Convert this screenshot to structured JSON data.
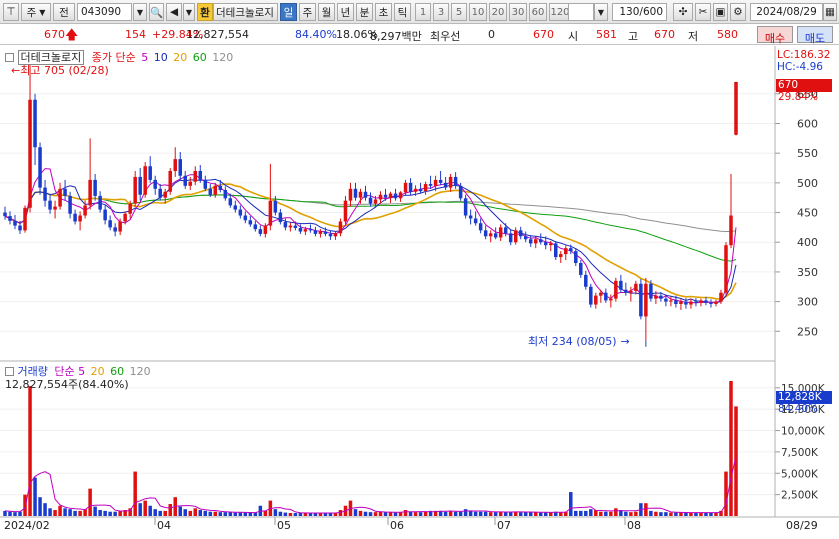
{
  "toolbar": {
    "type_label": "주",
    "market_label": "전",
    "code": "043090",
    "exchange_btn": "환",
    "stock_name": "더테크놀로지",
    "periods": [
      "일",
      "주",
      "월",
      "년",
      "분",
      "초",
      "틱"
    ],
    "active_period": "일",
    "intervals": [
      "1",
      "3",
      "5",
      "10",
      "20",
      "30",
      "60",
      "120"
    ],
    "count": "130/600",
    "date": "2024/08/29"
  },
  "quote": {
    "price": "670",
    "change": "154",
    "change_pct": "+29.84%",
    "volume": "12,827,554",
    "vol_ratio": "84.40%",
    "turnover": "18.06%",
    "amount": "8,297백만",
    "best_bid_label": "최우선",
    "best_bid": "0",
    "best_ask": "670",
    "open_label": "시",
    "open": "581",
    "high_label": "고",
    "high": "670",
    "low_label": "저",
    "low": "580",
    "buy_btn": "매수",
    "sell_btn": "매도"
  },
  "price_panel": {
    "name_tag": "더테크놀로지",
    "ma_label": "종가 단순",
    "ma_periods": [
      "5",
      "10",
      "20",
      "60",
      "120"
    ],
    "lc_label": "LC:186.32",
    "hc_label": "HC:-4.96",
    "current_price_tag": "670",
    "current_pct_tag": "29.84%",
    "high_annotation": "최고 705 (02/28)",
    "low_annotation": "최저 234 (08/05)",
    "y_ticks": [
      250,
      300,
      350,
      400,
      450,
      500,
      550,
      600,
      650
    ]
  },
  "volume_panel": {
    "label": "거래량",
    "ma_label": "단순",
    "ma_periods": [
      "5",
      "20",
      "60",
      "120"
    ],
    "volume_text": "12,827,554주(84.40%)",
    "current_tag": "12,828K",
    "current_pct_tag": "84.40%",
    "y_ticks": [
      "15,000K",
      "12,500K",
      "10,000K",
      "7,500K",
      "5,000K",
      "2,500K"
    ]
  },
  "x_axis": {
    "labels": [
      "2024/02",
      "04",
      "05",
      "06",
      "07",
      "08"
    ],
    "last_date": "08/29"
  },
  "colors": {
    "up": "#e01010",
    "down": "#1a3ccc",
    "ma5": "#c000c0",
    "ma10": "#1a2ab8",
    "ma20": "#e0a000",
    "ma60": "#10a010",
    "ma120": "#909090"
  },
  "chart_data": {
    "type": "candlestick",
    "y_range": [
      205,
      712
    ],
    "volume_range_k": [
      0,
      16500
    ],
    "candles": [
      [
        450,
        460,
        438,
        444,
        600
      ],
      [
        444,
        452,
        430,
        436,
        500
      ],
      [
        436,
        446,
        422,
        428,
        450
      ],
      [
        428,
        436,
        414,
        420,
        500
      ],
      [
        420,
        462,
        416,
        458,
        2500
      ],
      [
        458,
        705,
        450,
        640,
        15200
      ],
      [
        640,
        650,
        530,
        560,
        4500
      ],
      [
        560,
        568,
        480,
        492,
        2200
      ],
      [
        492,
        505,
        460,
        470,
        1500
      ],
      [
        470,
        480,
        448,
        455,
        900
      ],
      [
        455,
        470,
        440,
        460,
        700
      ],
      [
        460,
        500,
        455,
        490,
        1200
      ],
      [
        490,
        505,
        470,
        478,
        900
      ],
      [
        478,
        485,
        440,
        448,
        800
      ],
      [
        448,
        455,
        430,
        435,
        600
      ],
      [
        435,
        452,
        420,
        445,
        600
      ],
      [
        445,
        470,
        440,
        462,
        800
      ],
      [
        462,
        575,
        455,
        505,
        3200
      ],
      [
        505,
        515,
        470,
        478,
        1100
      ],
      [
        478,
        486,
        450,
        455,
        700
      ],
      [
        455,
        462,
        430,
        437,
        600
      ],
      [
        437,
        445,
        420,
        425,
        500
      ],
      [
        425,
        432,
        410,
        418,
        500
      ],
      [
        418,
        440,
        412,
        435,
        600
      ],
      [
        435,
        452,
        430,
        448,
        700
      ],
      [
        448,
        470,
        440,
        465,
        900
      ],
      [
        465,
        520,
        460,
        510,
        5200
      ],
      [
        510,
        525,
        470,
        480,
        1500
      ],
      [
        480,
        535,
        475,
        528,
        1800
      ],
      [
        528,
        545,
        500,
        505,
        1200
      ],
      [
        505,
        512,
        480,
        490,
        800
      ],
      [
        490,
        498,
        470,
        475,
        600
      ],
      [
        475,
        490,
        465,
        485,
        600
      ],
      [
        485,
        525,
        480,
        520,
        1400
      ],
      [
        520,
        560,
        510,
        540,
        2200
      ],
      [
        540,
        552,
        505,
        512,
        1100
      ],
      [
        512,
        520,
        490,
        495,
        800
      ],
      [
        495,
        510,
        488,
        502,
        600
      ],
      [
        502,
        528,
        496,
        520,
        900
      ],
      [
        520,
        530,
        500,
        505,
        700
      ],
      [
        505,
        512,
        486,
        490,
        600
      ],
      [
        490,
        498,
        476,
        480,
        500
      ],
      [
        480,
        500,
        475,
        495,
        500
      ],
      [
        495,
        505,
        484,
        488,
        450
      ],
      [
        488,
        494,
        470,
        474,
        450
      ],
      [
        474,
        482,
        458,
        462,
        450
      ],
      [
        462,
        470,
        450,
        455,
        400
      ],
      [
        455,
        462,
        440,
        445,
        400
      ],
      [
        445,
        452,
        432,
        437,
        400
      ],
      [
        437,
        444,
        426,
        430,
        400
      ],
      [
        430,
        436,
        418,
        422,
        400
      ],
      [
        422,
        428,
        410,
        414,
        1200
      ],
      [
        414,
        432,
        408,
        428,
        600
      ],
      [
        428,
        532,
        420,
        470,
        1800
      ],
      [
        470,
        478,
        445,
        450,
        800
      ],
      [
        450,
        456,
        430,
        434,
        500
      ],
      [
        434,
        440,
        420,
        425,
        400
      ],
      [
        425,
        433,
        418,
        428,
        350
      ],
      [
        428,
        435,
        420,
        424,
        350
      ],
      [
        424,
        430,
        414,
        418,
        350
      ],
      [
        418,
        426,
        412,
        422,
        350
      ],
      [
        422,
        430,
        416,
        420,
        350
      ],
      [
        420,
        426,
        410,
        414,
        350
      ],
      [
        414,
        422,
        408,
        418,
        350
      ],
      [
        418,
        425,
        410,
        414,
        350
      ],
      [
        414,
        420,
        404,
        410,
        350
      ],
      [
        410,
        418,
        404,
        415,
        350
      ],
      [
        415,
        440,
        410,
        435,
        700
      ],
      [
        435,
        478,
        430,
        470,
        1200
      ],
      [
        470,
        500,
        460,
        490,
        1800
      ],
      [
        490,
        500,
        470,
        475,
        800
      ],
      [
        475,
        490,
        465,
        485,
        600
      ],
      [
        485,
        495,
        470,
        475,
        500
      ],
      [
        475,
        484,
        460,
        465,
        450
      ],
      [
        465,
        478,
        458,
        472,
        450
      ],
      [
        472,
        486,
        465,
        480,
        500
      ],
      [
        480,
        490,
        470,
        475,
        450
      ],
      [
        475,
        485,
        466,
        482,
        450
      ],
      [
        482,
        490,
        470,
        474,
        400
      ],
      [
        474,
        486,
        468,
        484,
        450
      ],
      [
        484,
        505,
        478,
        500,
        700
      ],
      [
        500,
        508,
        480,
        485,
        500
      ],
      [
        485,
        496,
        478,
        490,
        450
      ],
      [
        490,
        500,
        482,
        486,
        450
      ],
      [
        486,
        502,
        480,
        498,
        500
      ],
      [
        498,
        512,
        490,
        495,
        600
      ],
      [
        495,
        512,
        486,
        505,
        600
      ],
      [
        505,
        520,
        496,
        500,
        600
      ],
      [
        500,
        510,
        488,
        492,
        500
      ],
      [
        492,
        515,
        485,
        510,
        600
      ],
      [
        510,
        518,
        490,
        495,
        500
      ],
      [
        495,
        500,
        470,
        474,
        500
      ],
      [
        474,
        480,
        440,
        445,
        800
      ],
      [
        445,
        455,
        430,
        440,
        600
      ],
      [
        440,
        452,
        428,
        432,
        500
      ],
      [
        432,
        440,
        415,
        420,
        500
      ],
      [
        420,
        428,
        405,
        410,
        500
      ],
      [
        410,
        420,
        400,
        415,
        450
      ],
      [
        415,
        425,
        405,
        408,
        450
      ],
      [
        408,
        430,
        402,
        425,
        500
      ],
      [
        425,
        432,
        410,
        415,
        450
      ],
      [
        415,
        422,
        395,
        400,
        500
      ],
      [
        400,
        425,
        396,
        420,
        500
      ],
      [
        420,
        426,
        405,
        410,
        450
      ],
      [
        410,
        418,
        400,
        405,
        450
      ],
      [
        405,
        412,
        392,
        398,
        450
      ],
      [
        398,
        410,
        390,
        405,
        450
      ],
      [
        405,
        415,
        396,
        400,
        400
      ],
      [
        400,
        410,
        388,
        395,
        400
      ],
      [
        395,
        402,
        385,
        398,
        400
      ],
      [
        398,
        402,
        370,
        375,
        500
      ],
      [
        375,
        385,
        365,
        380,
        450
      ],
      [
        380,
        395,
        370,
        390,
        500
      ],
      [
        390,
        396,
        380,
        385,
        2800
      ],
      [
        385,
        390,
        360,
        365,
        600
      ],
      [
        365,
        370,
        340,
        345,
        600
      ],
      [
        345,
        352,
        320,
        325,
        600
      ],
      [
        325,
        330,
        290,
        295,
        800
      ],
      [
        295,
        315,
        288,
        310,
        700
      ],
      [
        310,
        320,
        298,
        315,
        500
      ],
      [
        315,
        322,
        298,
        302,
        500
      ],
      [
        302,
        312,
        290,
        305,
        500
      ],
      [
        305,
        340,
        300,
        335,
        900
      ],
      [
        335,
        345,
        315,
        320,
        700
      ],
      [
        320,
        332,
        310,
        315,
        500
      ],
      [
        315,
        325,
        300,
        318,
        450
      ],
      [
        318,
        335,
        312,
        330,
        500
      ],
      [
        330,
        338,
        270,
        275,
        1500
      ],
      [
        275,
        340,
        234,
        330,
        1500
      ],
      [
        330,
        336,
        300,
        305,
        600
      ],
      [
        305,
        318,
        296,
        310,
        500
      ],
      [
        310,
        316,
        300,
        305,
        450
      ],
      [
        305,
        312,
        292,
        300,
        450
      ],
      [
        300,
        308,
        292,
        302,
        400
      ],
      [
        302,
        310,
        290,
        296,
        400
      ],
      [
        296,
        304,
        286,
        300,
        400
      ],
      [
        300,
        306,
        288,
        295,
        400
      ],
      [
        295,
        305,
        288,
        300,
        400
      ],
      [
        300,
        306,
        292,
        298,
        400
      ],
      [
        298,
        305,
        292,
        302,
        400
      ],
      [
        302,
        308,
        294,
        298,
        400
      ],
      [
        298,
        304,
        290,
        296,
        400
      ],
      [
        296,
        303,
        292,
        300,
        400
      ],
      [
        300,
        320,
        296,
        315,
        600
      ],
      [
        315,
        400,
        310,
        395,
        5200
      ],
      [
        395,
        515,
        390,
        445,
        15800
      ],
      [
        581,
        670,
        580,
        670,
        12828
      ]
    ],
    "ma_periods": [
      5,
      10,
      20,
      60,
      120
    ],
    "annotations": [
      {
        "text": "최고 705 (02/28)",
        "value": 705
      },
      {
        "text": "최저 234 (08/05)",
        "value": 234
      }
    ]
  }
}
